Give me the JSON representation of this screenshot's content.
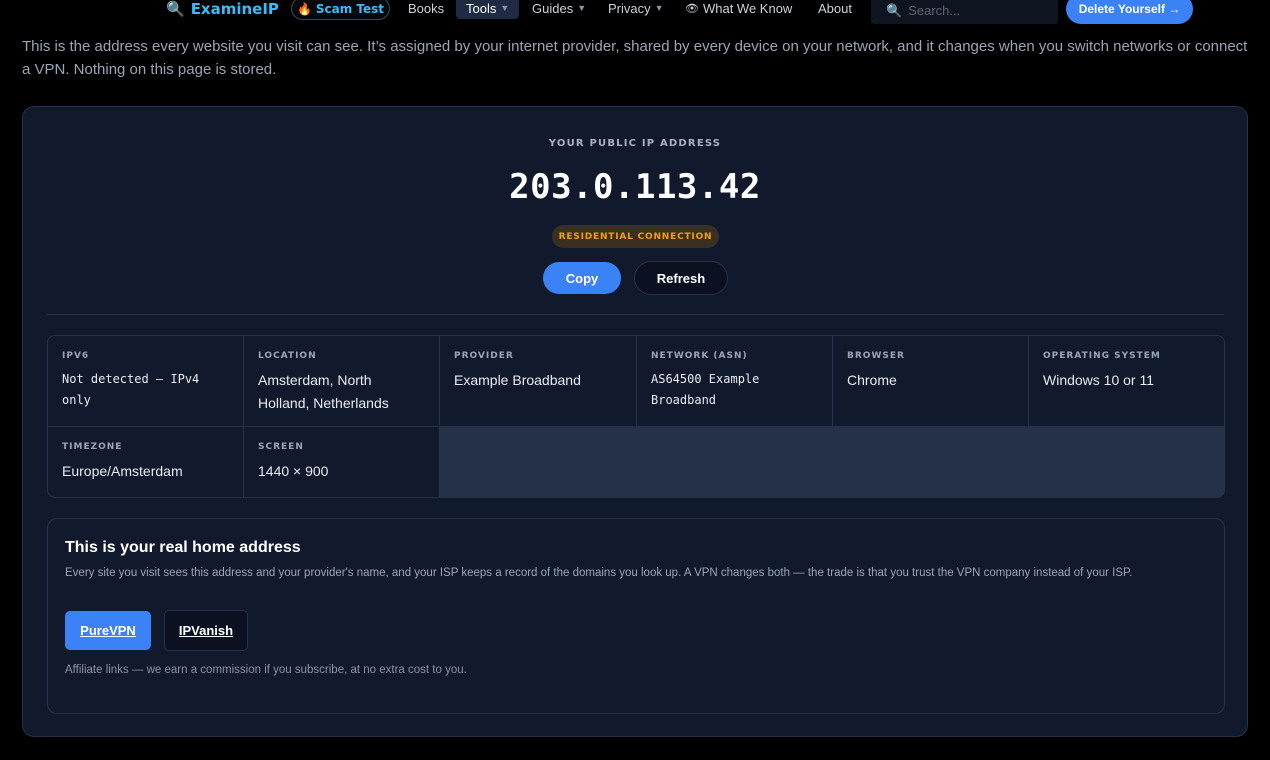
{
  "nav": {
    "logo_icon": "magnifier-icon",
    "logo_text": "ExamineIP",
    "scam_test_icon": "fire-icon",
    "scam_test_label": "Scam Test",
    "items": [
      {
        "label": "Books",
        "has_dropdown": false
      },
      {
        "label": "Tools",
        "has_dropdown": true,
        "active": true
      },
      {
        "label": "Guides",
        "has_dropdown": true
      },
      {
        "label": "Privacy",
        "has_dropdown": true
      },
      {
        "label": "What We Know",
        "icon": "eye-icon",
        "has_dropdown": false
      },
      {
        "label": "About",
        "has_dropdown": false
      }
    ],
    "caret": "▼",
    "search_placeholder": "Search...",
    "cta_label": "Delete Yourself →"
  },
  "intro": {
    "text": "This is the address every website you visit can see. It’s assigned by your internet provider, shared by every device on your network, and it changes when you switch networks or connect a VPN. Nothing on this page is stored."
  },
  "ip_card": {
    "label": "YOUR PUBLIC IP ADDRESS",
    "address": "203.0.113.42",
    "connection_badge": "RESIDENTIAL CONNECTION",
    "copy_label": "Copy",
    "refresh_label": "Refresh"
  },
  "details": [
    {
      "label": "IPV6",
      "value": "Not detected — IPv4 only",
      "mono": true
    },
    {
      "label": "LOCATION",
      "value": "Amsterdam, North Holland, Netherlands",
      "mono": false
    },
    {
      "label": "PROVIDER",
      "value": "Example Broadband",
      "mono": false
    },
    {
      "label": "NETWORK (ASN)",
      "value": "AS64500 Example Broadband",
      "mono": true
    },
    {
      "label": "BROWSER",
      "value": "Chrome",
      "mono": false
    },
    {
      "label": "OPERATING SYSTEM",
      "value": "Windows 10 or 11",
      "mono": false
    },
    {
      "label": "TIMEZONE",
      "value": "Europe/Amsterdam",
      "mono": false
    },
    {
      "label": "SCREEN",
      "value": "1440 × 900",
      "mono": false
    }
  ],
  "vpn": {
    "title": "This is your real home address",
    "description": "Every site you visit sees this address and your provider's name, and your ISP keeps a record of the domains you look up. A VPN changes both — the trade is that you trust the VPN company instead of your ISP.",
    "primary_label": "PureVPN",
    "secondary_label": "IPVanish",
    "note": "Affiliate links — we earn a commission if you subscribe, at no extra cost to you."
  },
  "colors": {
    "background": "#000000",
    "card": "#111a2c",
    "border": "#273148",
    "accent_blue": "#3b82f6",
    "logo_cyan": "#38bdf8",
    "badge_amber": "#f59e0b"
  }
}
